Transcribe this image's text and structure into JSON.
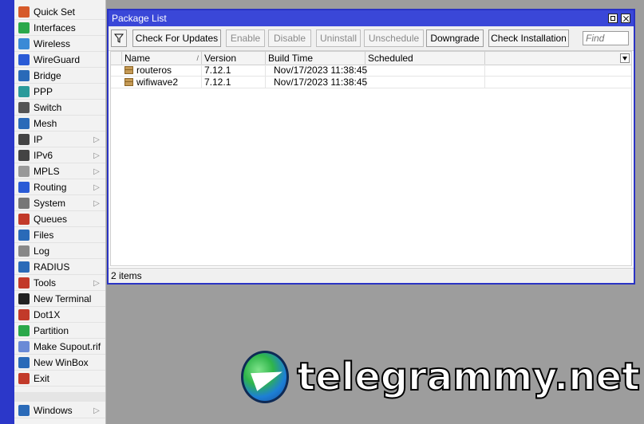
{
  "sidebar": {
    "items": [
      {
        "label": "Quick Set",
        "icon": "quick-set-icon",
        "arrow": false,
        "color": "#d65a2a"
      },
      {
        "label": "Interfaces",
        "icon": "interfaces-icon",
        "arrow": false,
        "color": "#2aa84a"
      },
      {
        "label": "Wireless",
        "icon": "wireless-icon",
        "arrow": false,
        "color": "#3a8ad6"
      },
      {
        "label": "WireGuard",
        "icon": "wireguard-icon",
        "arrow": false,
        "color": "#2a5bd6"
      },
      {
        "label": "Bridge",
        "icon": "bridge-icon",
        "arrow": false,
        "color": "#2a6ab8"
      },
      {
        "label": "PPP",
        "icon": "ppp-icon",
        "arrow": false,
        "color": "#2a9a9a"
      },
      {
        "label": "Switch",
        "icon": "switch-icon",
        "arrow": false,
        "color": "#555555"
      },
      {
        "label": "Mesh",
        "icon": "mesh-icon",
        "arrow": false,
        "color": "#2a6ab8"
      },
      {
        "label": "IP",
        "icon": "ip-icon",
        "arrow": true,
        "color": "#444444"
      },
      {
        "label": "IPv6",
        "icon": "ipv6-icon",
        "arrow": true,
        "color": "#444444"
      },
      {
        "label": "MPLS",
        "icon": "mpls-icon",
        "arrow": true,
        "color": "#999999"
      },
      {
        "label": "Routing",
        "icon": "routing-icon",
        "arrow": true,
        "color": "#2a5bd6"
      },
      {
        "label": "System",
        "icon": "system-icon",
        "arrow": true,
        "color": "#777777"
      },
      {
        "label": "Queues",
        "icon": "queues-icon",
        "arrow": false,
        "color": "#c23a2a"
      },
      {
        "label": "Files",
        "icon": "files-icon",
        "arrow": false,
        "color": "#2a6ab8"
      },
      {
        "label": "Log",
        "icon": "log-icon",
        "arrow": false,
        "color": "#888888"
      },
      {
        "label": "RADIUS",
        "icon": "radius-icon",
        "arrow": false,
        "color": "#2a6ab8"
      },
      {
        "label": "Tools",
        "icon": "tools-icon",
        "arrow": true,
        "color": "#c23a2a"
      },
      {
        "label": "New Terminal",
        "icon": "terminal-icon",
        "arrow": false,
        "color": "#222222"
      },
      {
        "label": "Dot1X",
        "icon": "dot1x-icon",
        "arrow": false,
        "color": "#c23a2a"
      },
      {
        "label": "Partition",
        "icon": "partition-icon",
        "arrow": false,
        "color": "#2aa84a"
      },
      {
        "label": "Make Supout.rif",
        "icon": "supout-icon",
        "arrow": false,
        "color": "#6a8ad6"
      },
      {
        "label": "New WinBox",
        "icon": "winbox-icon",
        "arrow": false,
        "color": "#2a6ab8"
      },
      {
        "label": "Exit",
        "icon": "exit-icon",
        "arrow": false,
        "color": "#c23a2a"
      }
    ],
    "bottom_item": {
      "label": "Windows",
      "icon": "windows-icon",
      "arrow": true,
      "color": "#2a6ab8"
    }
  },
  "window": {
    "title": "Package List",
    "toolbar": {
      "filter_icon": "filter-icon",
      "buttons": [
        {
          "label": "Check For Updates",
          "enabled": true
        },
        {
          "label": "Enable",
          "enabled": false
        },
        {
          "label": "Disable",
          "enabled": false
        },
        {
          "label": "Uninstall",
          "enabled": false
        },
        {
          "label": "Unschedule",
          "enabled": false
        },
        {
          "label": "Downgrade",
          "enabled": true
        },
        {
          "label": "Check Installation",
          "enabled": true
        }
      ],
      "find_placeholder": "Find"
    },
    "table": {
      "columns": [
        "Name",
        "Version",
        "Build Time",
        "Scheduled"
      ],
      "rows": [
        {
          "name": "routeros",
          "version": "7.12.1",
          "build_time": "Nov/17/2023 11:38:45",
          "scheduled": ""
        },
        {
          "name": "wifiwave2",
          "version": "7.12.1",
          "build_time": "Nov/17/2023 11:38:45",
          "scheduled": ""
        }
      ]
    },
    "status": "2 items"
  },
  "watermark": {
    "text": "telegrammy.net"
  }
}
